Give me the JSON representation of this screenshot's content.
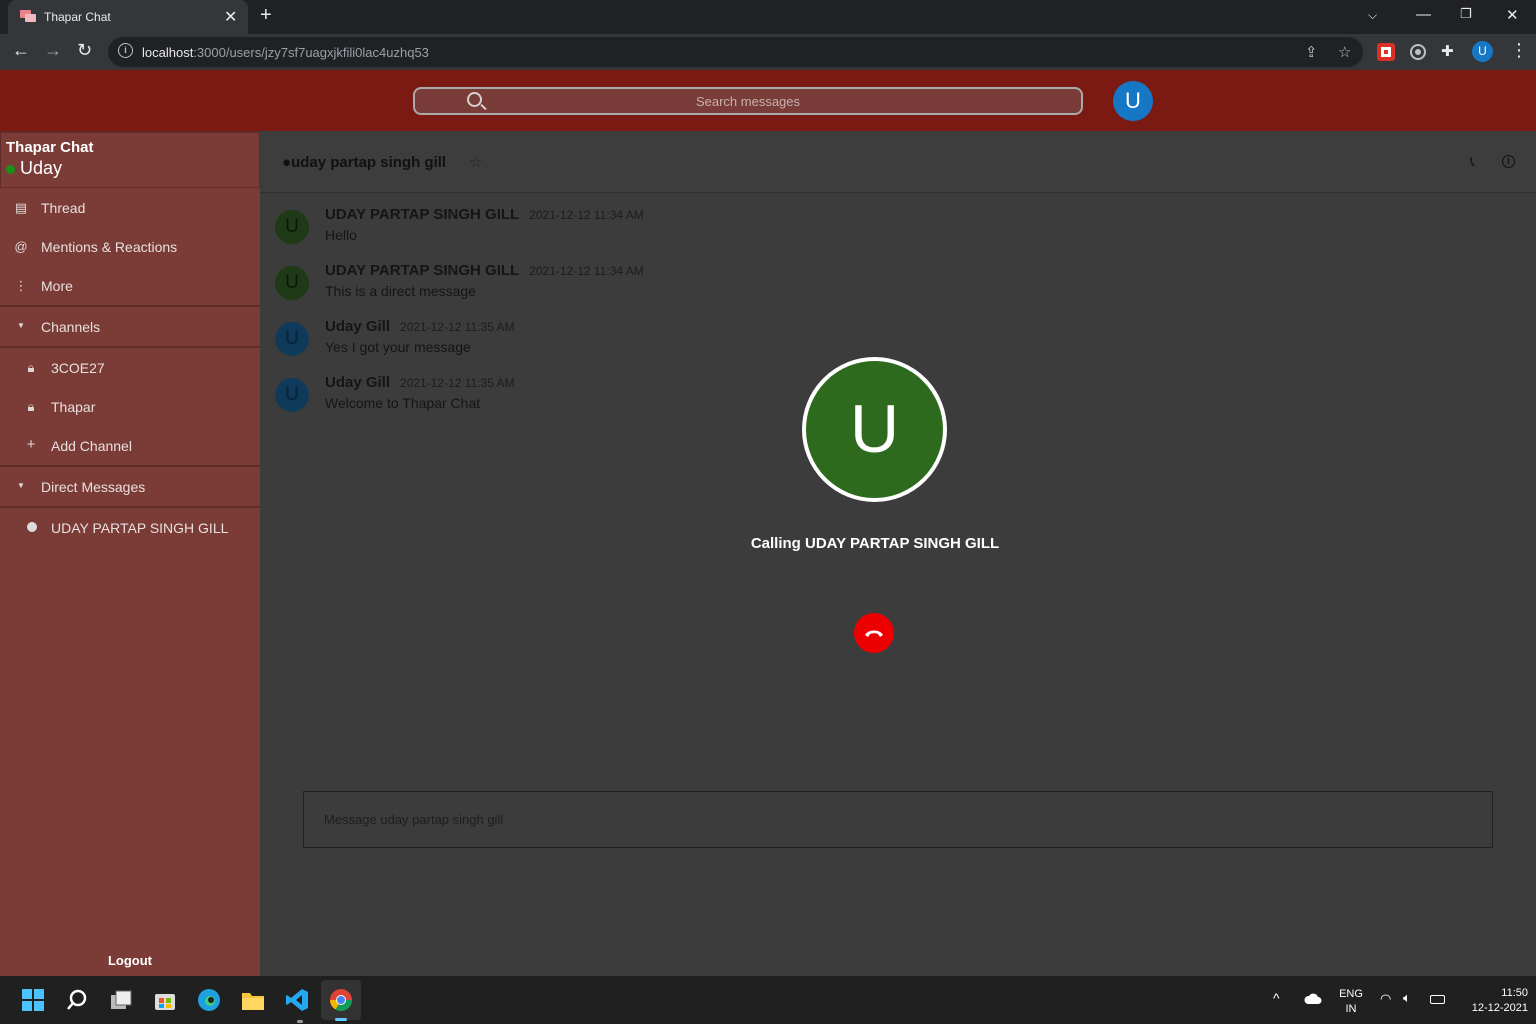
{
  "browser": {
    "tab_title": "Thapar Chat",
    "url_host": "localhost",
    "url_path": ":3000/users/jzy7sf7uagxjkfili0lac4uzhq53",
    "profile_initial": "U"
  },
  "header": {
    "search_placeholder": "Search messages",
    "avatar_initial": "U"
  },
  "sidebar": {
    "workspace_name": "Thapar Chat",
    "current_user": "Uday",
    "items": [
      {
        "icon": "thread-icon",
        "label": "Thread"
      },
      {
        "icon": "at-icon",
        "label": "Mentions & Reactions"
      },
      {
        "icon": "more-icon",
        "label": "More"
      }
    ],
    "channels_header": "Channels",
    "channels": [
      {
        "icon": "lock-icon",
        "label": "3COE27"
      },
      {
        "icon": "lock-icon",
        "label": "Thapar"
      }
    ],
    "add_channel_label": "Add Channel",
    "dm_header": "Direct Messages",
    "direct_messages": [
      {
        "label": "UDAY PARTAP SINGH GILL"
      }
    ],
    "logout_label": "Logout"
  },
  "chat": {
    "title": "uday partap singh gill",
    "messages": [
      {
        "initial": "U",
        "author": "UDAY PARTAP SINGH GILL",
        "time": "2021-12-12 11:34 AM",
        "text": "Hello",
        "avatar_color": "#1f3a17"
      },
      {
        "initial": "U",
        "author": "UDAY PARTAP SINGH GILL",
        "time": "2021-12-12 11:34 AM",
        "text": "This is a direct message",
        "avatar_color": "#1f3a17"
      },
      {
        "initial": "U",
        "author": "Uday Gill",
        "time": "2021-12-12 11:35 AM",
        "text": "Yes I got your message",
        "avatar_color": "#103a5a"
      },
      {
        "initial": "U",
        "author": "Uday Gill",
        "time": "2021-12-12 11:35 AM",
        "text": "Welcome to Thapar Chat",
        "avatar_color": "#103a5a"
      }
    ],
    "compose_placeholder": "Message uday partap singh gill"
  },
  "call": {
    "avatar_initial": "U",
    "status_text": "Calling UDAY PARTAP SINGH GILL"
  },
  "taskbar": {
    "lang_line1": "ENG",
    "lang_line2": "IN",
    "time": "11:50",
    "date": "12-12-2021"
  }
}
